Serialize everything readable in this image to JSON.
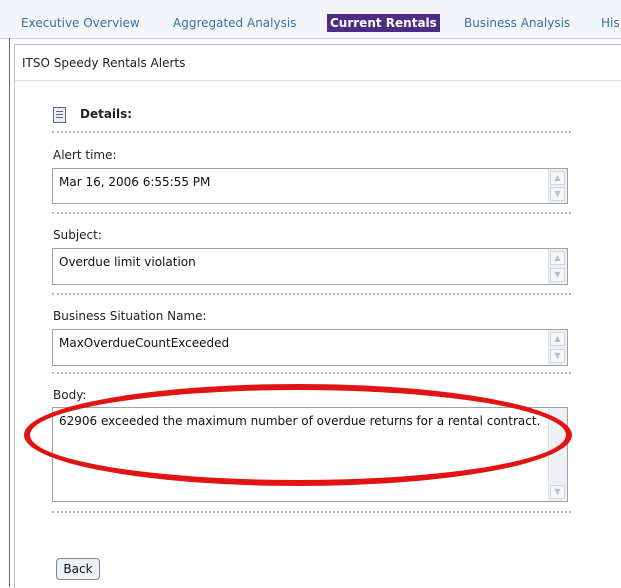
{
  "tabs": [
    {
      "label": "Executive Overview",
      "active": false
    },
    {
      "label": "Aggregated Analysis",
      "active": false
    },
    {
      "label": "Current Rentals",
      "active": true
    },
    {
      "label": "Business Analysis",
      "active": false
    },
    {
      "label": "His",
      "active": false
    }
  ],
  "portlet": {
    "title": "ITSO Speedy Rentals Alerts"
  },
  "details": {
    "heading": "Details:",
    "icon": "document-list-icon",
    "alert_time": {
      "label": "Alert time:",
      "value": "Mar 16, 2006 6:55:55 PM"
    },
    "subject": {
      "label": "Subject:",
      "value": "Overdue limit violation"
    },
    "business_situation": {
      "label": "Business Situation Name:",
      "value": "MaxOverdueCountExceeded"
    },
    "body": {
      "label": "Body:",
      "value": "62906 exceeded the maximum number of overdue returns for a rental contract."
    }
  },
  "annotation": {
    "color": "#e21313"
  },
  "back_label": "Back",
  "colors": {
    "active_tab": "#4d2c86",
    "tab_text": "#3c6fa5"
  }
}
